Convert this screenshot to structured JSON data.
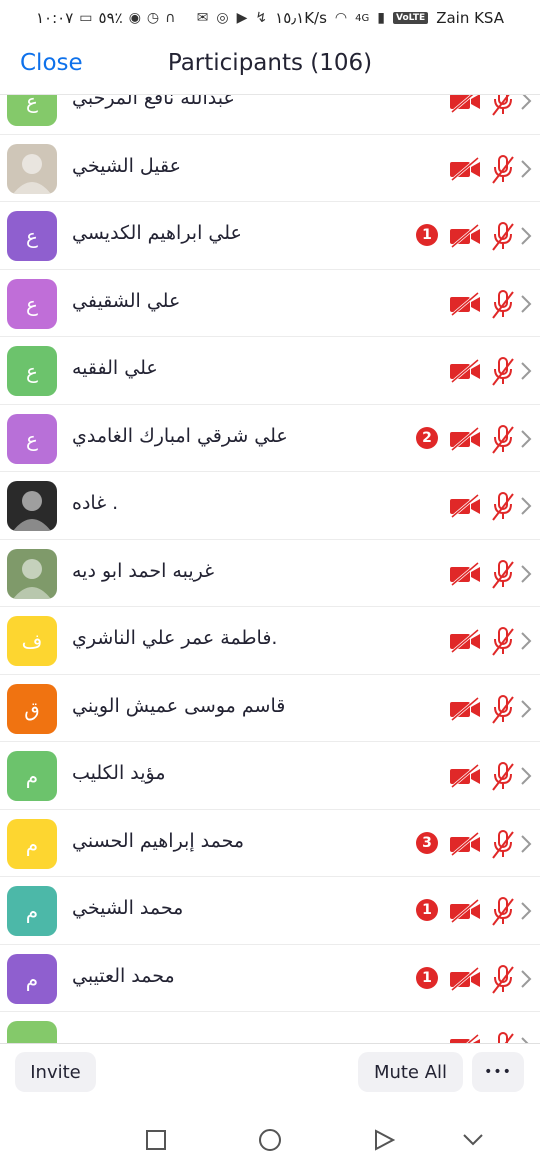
{
  "status_bar": {
    "time": "١٠:٠٧",
    "battery": "٥٩٪",
    "speed": "١٥٫١K/s",
    "network": "4G",
    "volte": "VoLTE",
    "carrier": "Zain KSA"
  },
  "header": {
    "close_label": "Close",
    "title": "Participants (106)"
  },
  "colors": {
    "accent": "#0e71eb",
    "muted_red": "#e02828",
    "green": "#6cc36c",
    "purple": "#8f5fcf",
    "violet": "#b870d8",
    "yellow": "#fdd630",
    "orange": "#f07311",
    "teal": "#4cb8a8"
  },
  "participants": [
    {
      "name": "عبدالله نافع المرحبي",
      "initial": "ع",
      "avatar_color": "#84c96a",
      "badge": ""
    },
    {
      "name": "عقيل الشيخي",
      "initial": "",
      "avatar_color": "#cfc6b8",
      "avatar_type": "photo",
      "badge": ""
    },
    {
      "name": "علي ابراهيم الكديسي",
      "initial": "ع",
      "avatar_color": "#8f5fcf",
      "badge": "1"
    },
    {
      "name": "علي الشقيفي",
      "initial": "ع",
      "avatar_color": "#c06ed8",
      "badge": ""
    },
    {
      "name": "علي الفقيه",
      "initial": "ع",
      "avatar_color": "#6cc36c",
      "badge": ""
    },
    {
      "name": "علي شرقي امبارك الغامدي",
      "initial": "ع",
      "avatar_color": "#b870d8",
      "badge": "2"
    },
    {
      "name": "غاده .",
      "initial": "",
      "avatar_color": "#2a2a2a",
      "avatar_type": "photo",
      "badge": ""
    },
    {
      "name": "غريبه احمد ابو ديه",
      "initial": "",
      "avatar_color": "#7f9a6a",
      "avatar_type": "photo",
      "badge": ""
    },
    {
      "name": "فاطمة عمر علي الناشري.",
      "initial": "ف",
      "avatar_color": "#fdd630",
      "badge": ""
    },
    {
      "name": "قاسم موسى عميش الويني",
      "initial": "ق",
      "avatar_color": "#f07311",
      "badge": ""
    },
    {
      "name": "مؤيد الكليب",
      "initial": "م",
      "avatar_color": "#6cc36c",
      "badge": ""
    },
    {
      "name": "محمد إبراهيم الحسني",
      "initial": "م",
      "avatar_color": "#fdd630",
      "badge": "3"
    },
    {
      "name": "محمد الشيخي",
      "initial": "م",
      "avatar_color": "#4cb8a8",
      "badge": "1"
    },
    {
      "name": "محمد العتيبي",
      "initial": "م",
      "avatar_color": "#8f5fcf",
      "badge": "1"
    },
    {
      "name": "",
      "initial": "",
      "avatar_color": "#84c96a",
      "badge": ""
    }
  ],
  "footer": {
    "invite_label": "Invite",
    "mute_all_label": "Mute All",
    "more_label": "•••"
  }
}
